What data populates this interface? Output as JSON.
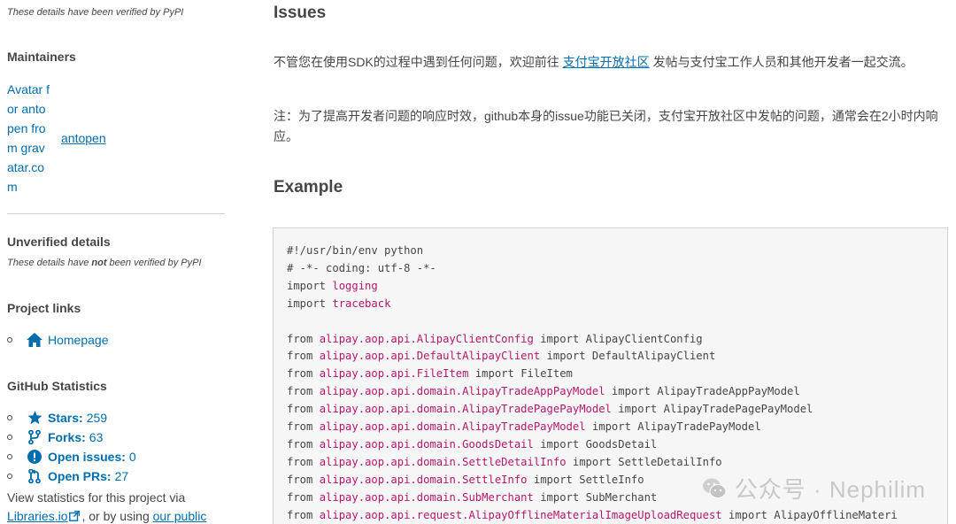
{
  "sidebar": {
    "verified_note": "These details have been verified by PyPI",
    "maintainers_title": "Maintainers",
    "avatar_alt": "Avatar for antopen from gravatar.com",
    "maintainer_name": "antopen",
    "unverified_title": "Unverified details",
    "unverified_note_pre": "These details have ",
    "unverified_note_bold": "not",
    "unverified_note_post": " been verified by PyPI",
    "project_links_title": "Project links",
    "homepage_label": "Homepage",
    "github_stats_title": "GitHub Statistics",
    "stats": [
      {
        "label": "Stars:",
        "value": "259",
        "icon": "star-icon"
      },
      {
        "label": "Forks:",
        "value": "63",
        "icon": "fork-icon"
      },
      {
        "label": "Open issues:",
        "value": "0",
        "icon": "issue-icon"
      },
      {
        "label": "Open PRs:",
        "value": "27",
        "icon": "pull-request-icon"
      }
    ],
    "stats_text_pre": "View statistics for this project via",
    "libraries_link": "Libraries.io",
    "stats_text_mid": ", or by using",
    "public_link": "our public"
  },
  "main": {
    "issues_title": "Issues",
    "issues_p1_pre": "不管您在使用SDK的过程中遇到任何问题，欢迎前往 ",
    "issues_p1_link": "支付宝开放社区",
    "issues_p1_post": " 发帖与支付宝工作人员和其他开发者一起交流。",
    "issues_p2": "注：为了提高开发者问题的响应时效，github本身的issue功能已关闭，支付宝开放社区中发帖的问题，通常会在2小时内响应。",
    "example_title": "Example",
    "code_lines": [
      {
        "k": "comment",
        "t": "#!/usr/bin/env python"
      },
      {
        "k": "comment",
        "t": "# -*- coding: utf-8 -*-"
      },
      {
        "k": "import",
        "kw": "import",
        "mod": "logging"
      },
      {
        "k": "import",
        "kw": "import",
        "mod": "traceback"
      },
      {
        "k": "blank"
      },
      {
        "k": "from",
        "mod": "alipay.aop.api.AlipayClientConfig",
        "name": "AlipayClientConfig"
      },
      {
        "k": "from",
        "mod": "alipay.aop.api.DefaultAlipayClient",
        "name": "DefaultAlipayClient"
      },
      {
        "k": "from",
        "mod": "alipay.aop.api.FileItem",
        "name": "FileItem"
      },
      {
        "k": "from",
        "mod": "alipay.aop.api.domain.AlipayTradeAppPayModel",
        "name": "AlipayTradeAppPayModel"
      },
      {
        "k": "from",
        "mod": "alipay.aop.api.domain.AlipayTradePagePayModel",
        "name": "AlipayTradePagePayModel"
      },
      {
        "k": "from",
        "mod": "alipay.aop.api.domain.AlipayTradePayModel",
        "name": "AlipayTradePayModel"
      },
      {
        "k": "from",
        "mod": "alipay.aop.api.domain.GoodsDetail",
        "name": "GoodsDetail"
      },
      {
        "k": "from",
        "mod": "alipay.aop.api.domain.SettleDetailInfo",
        "name": "SettleDetailInfo"
      },
      {
        "k": "from",
        "mod": "alipay.aop.api.domain.SettleInfo",
        "name": "SettleInfo"
      },
      {
        "k": "from",
        "mod": "alipay.aop.api.domain.SubMerchant",
        "name": "SubMerchant"
      },
      {
        "k": "from",
        "mod": "alipay.aop.api.request.AlipayOfflineMaterialImageUploadRequest",
        "name": "AlipayOfflineMateri"
      }
    ]
  },
  "watermark": {
    "text": "公众号 · Nephilim"
  },
  "colors": {
    "link": "#006dad",
    "text": "#464646",
    "code_module": "#b5186b",
    "code_bg": "#f6f6f6"
  }
}
